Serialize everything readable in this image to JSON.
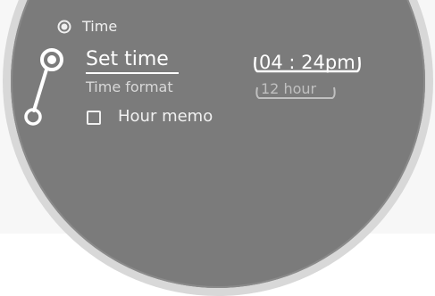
{
  "header": {
    "title": "Time",
    "icon": "time-icon"
  },
  "items": {
    "set_time": {
      "label": "Set time",
      "value": "04 : 24pm"
    },
    "time_format": {
      "label": "Time format",
      "value": "12 hour"
    },
    "hour_memo": {
      "label": "Hour memo",
      "checked": false
    }
  },
  "colors": {
    "screen": "#7b7b7b",
    "bezel": "#d8d8d8",
    "text": "#ffffff"
  }
}
